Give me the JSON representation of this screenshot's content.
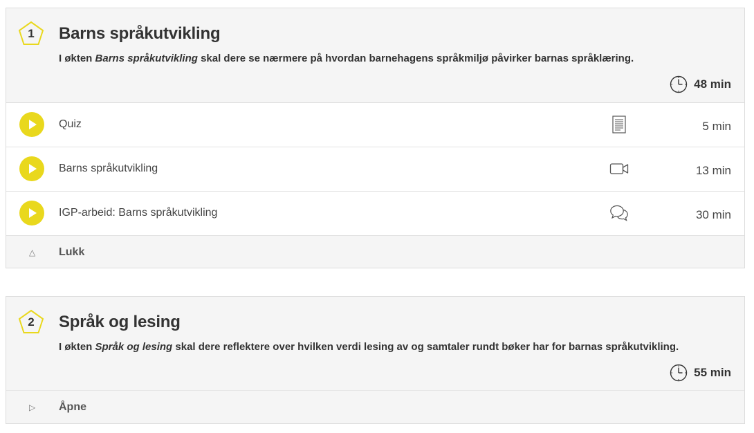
{
  "sessions": [
    {
      "number": "1",
      "title": "Barns språkutvikling",
      "desc_prefix": "I økten ",
      "desc_em": "Barns språkutvikling",
      "desc_suffix": " skal dere se nærmere på hvordan barnehagens språkmiljø påvirker barnas språklæring.",
      "total_time": "48 min",
      "items": [
        {
          "label": "Quiz",
          "icon": "document-icon",
          "duration": "5 min"
        },
        {
          "label": "Barns språkutvikling",
          "icon": "video-camera-icon",
          "duration": "13 min"
        },
        {
          "label": "IGP-arbeid: Barns språkutvikling",
          "icon": "chat-bubbles-icon",
          "duration": "30 min"
        }
      ],
      "toggle_label": "Lukk",
      "toggle_icon": "collapse-up-triangle-icon"
    },
    {
      "number": "2",
      "title": "Språk og lesing",
      "desc_prefix": "I økten ",
      "desc_em": "Språk og lesing",
      "desc_suffix": " skal dere reflektere over hvilken verdi lesing av og samtaler rundt bøker har for barnas språkutvikling.",
      "total_time": "55 min",
      "toggle_label": "Åpne",
      "toggle_icon": "expand-right-triangle-icon"
    }
  ],
  "colors": {
    "accent_yellow": "#e9d81d",
    "header_bg": "#f5f5f5",
    "border": "#dcdcdc"
  }
}
